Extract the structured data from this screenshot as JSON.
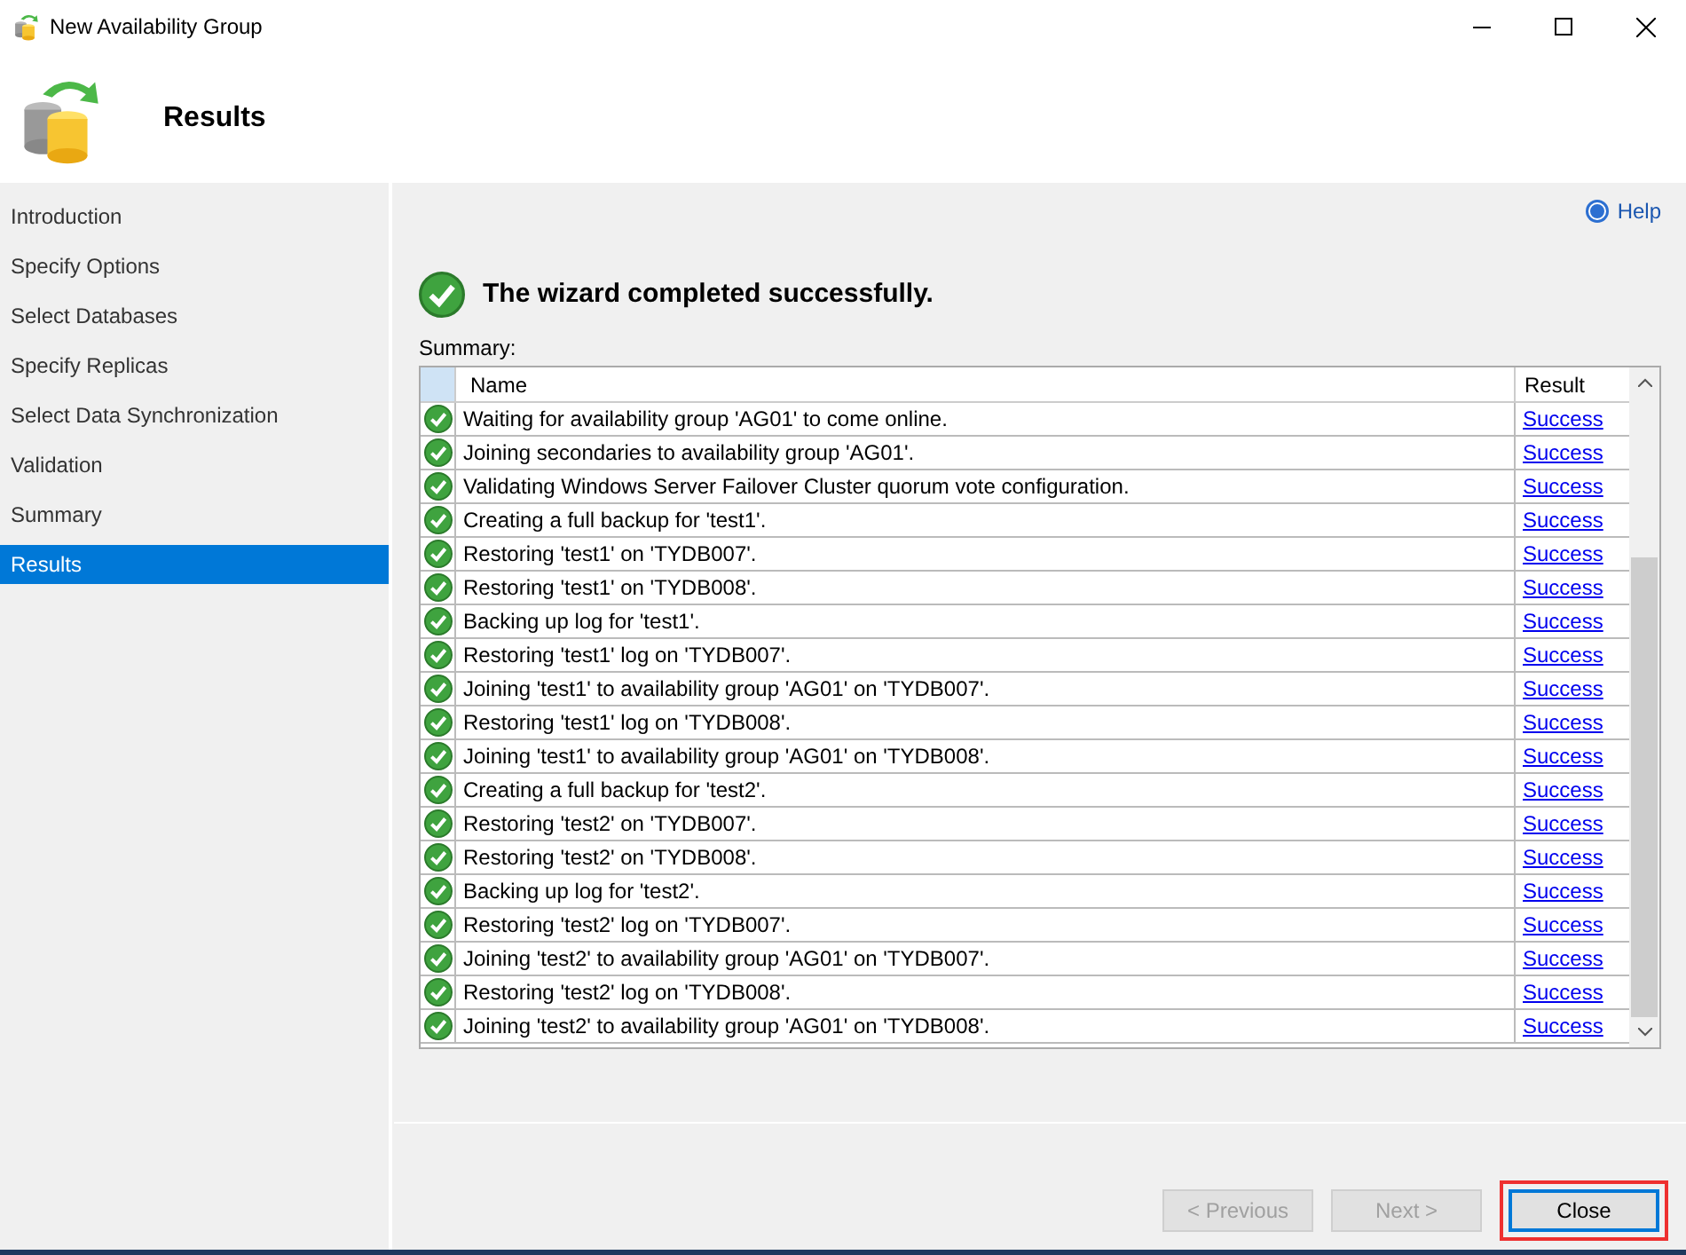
{
  "window": {
    "title": "New Availability Group"
  },
  "header": {
    "title": "Results"
  },
  "sidebar": {
    "items": [
      {
        "label": "Introduction",
        "selected": false
      },
      {
        "label": "Specify Options",
        "selected": false
      },
      {
        "label": "Select Databases",
        "selected": false
      },
      {
        "label": "Specify Replicas",
        "selected": false
      },
      {
        "label": "Select Data Synchronization",
        "selected": false
      },
      {
        "label": "Validation",
        "selected": false
      },
      {
        "label": "Summary",
        "selected": false
      },
      {
        "label": "Results",
        "selected": true
      }
    ]
  },
  "help": "Help",
  "status_message": "The wizard completed successfully.",
  "summary_label": "Summary:",
  "table": {
    "columns": [
      "Name",
      "Result"
    ],
    "rows": [
      {
        "name": "Waiting for availability group 'AG01' to come online.",
        "result": "Success"
      },
      {
        "name": "Joining secondaries to availability group 'AG01'.",
        "result": "Success"
      },
      {
        "name": "Validating Windows Server Failover Cluster quorum vote configuration.",
        "result": "Success"
      },
      {
        "name": "Creating a full backup for 'test1'.",
        "result": "Success"
      },
      {
        "name": "Restoring 'test1' on 'TYDB007'.",
        "result": "Success"
      },
      {
        "name": "Restoring 'test1' on 'TYDB008'.",
        "result": "Success"
      },
      {
        "name": "Backing up log for 'test1'.",
        "result": "Success"
      },
      {
        "name": "Restoring 'test1' log on 'TYDB007'.",
        "result": "Success"
      },
      {
        "name": "Joining 'test1' to availability group 'AG01' on 'TYDB007'.",
        "result": "Success"
      },
      {
        "name": "Restoring 'test1' log on 'TYDB008'.",
        "result": "Success"
      },
      {
        "name": "Joining 'test1' to availability group 'AG01' on 'TYDB008'.",
        "result": "Success"
      },
      {
        "name": "Creating a full backup for 'test2'.",
        "result": "Success"
      },
      {
        "name": "Restoring 'test2' on 'TYDB007'.",
        "result": "Success"
      },
      {
        "name": "Restoring 'test2' on 'TYDB008'.",
        "result": "Success"
      },
      {
        "name": "Backing up log for 'test2'.",
        "result": "Success"
      },
      {
        "name": "Restoring 'test2' log on 'TYDB007'.",
        "result": "Success"
      },
      {
        "name": "Joining 'test2' to availability group 'AG01' on 'TYDB007'.",
        "result": "Success"
      },
      {
        "name": "Restoring 'test2' log on 'TYDB008'.",
        "result": "Success"
      },
      {
        "name": "Joining 'test2' to availability group 'AG01' on 'TYDB008'.",
        "result": "Success"
      }
    ]
  },
  "buttons": [
    {
      "label": "< Previous",
      "disabled": true,
      "highlighted": false
    },
    {
      "label": "Next >",
      "disabled": true,
      "highlighted": false
    },
    {
      "label": "Close",
      "disabled": false,
      "highlighted": true
    }
  ]
}
